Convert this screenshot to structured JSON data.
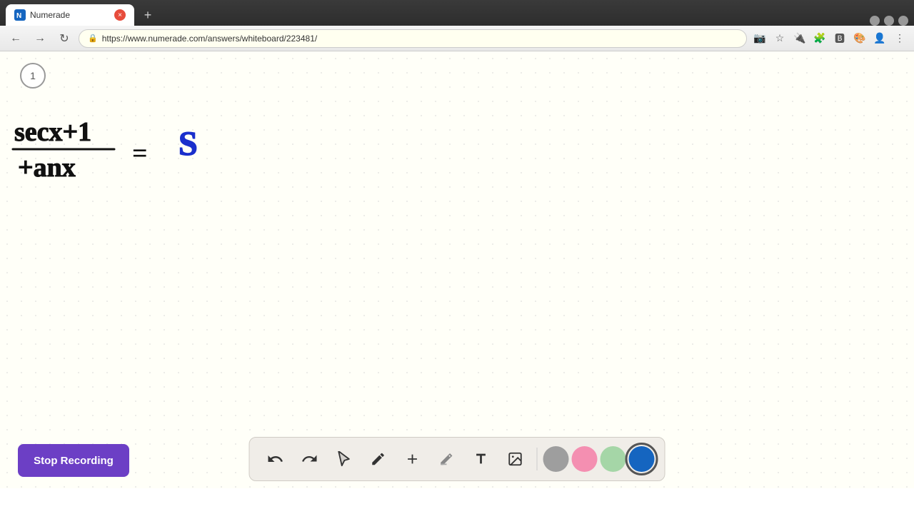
{
  "browser": {
    "tab_title": "Numerade",
    "tab_close_icon": "×",
    "tab_new_icon": "+",
    "url": "https://www.numerade.com/answers/whiteboard/223481/",
    "nav": {
      "back_icon": "←",
      "forward_icon": "→",
      "refresh_icon": "↻"
    }
  },
  "whiteboard": {
    "page_number": "1",
    "background_color": "#fffff8"
  },
  "toolbar": {
    "tools": [
      {
        "name": "undo",
        "icon": "↩",
        "label": "Undo"
      },
      {
        "name": "redo",
        "icon": "↪",
        "label": "Redo"
      },
      {
        "name": "select",
        "icon": "▲",
        "label": "Select"
      },
      {
        "name": "pen",
        "icon": "✏",
        "label": "Pen"
      },
      {
        "name": "add",
        "icon": "+",
        "label": "Add"
      },
      {
        "name": "eraser",
        "icon": "⌫",
        "label": "Eraser"
      },
      {
        "name": "text",
        "icon": "A",
        "label": "Text"
      },
      {
        "name": "image",
        "icon": "🖼",
        "label": "Image"
      }
    ],
    "colors": [
      {
        "name": "gray",
        "value": "#9e9e9e"
      },
      {
        "name": "pink",
        "value": "#f48fb1"
      },
      {
        "name": "green",
        "value": "#a5d6a7"
      },
      {
        "name": "blue",
        "value": "#1565c0"
      }
    ],
    "active_color": "#1565c0"
  },
  "stop_recording": {
    "label": "Stop Recording",
    "bg_color": "#6c3fc5"
  }
}
